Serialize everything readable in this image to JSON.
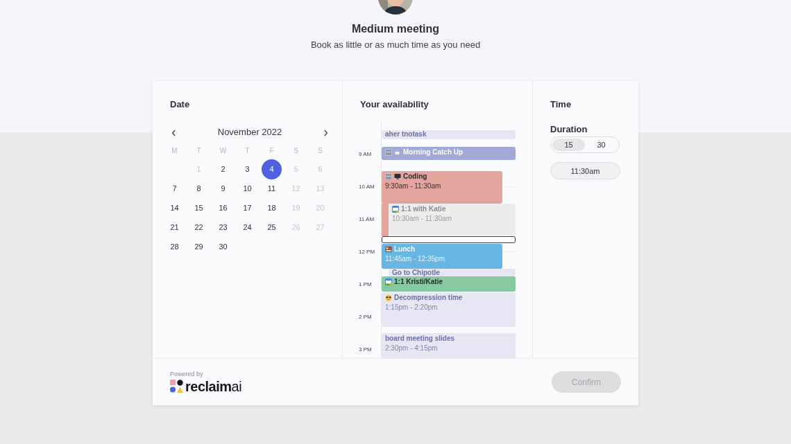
{
  "header": {
    "title": "Medium meeting",
    "subtitle": "Book as little or as much time as you need"
  },
  "date": {
    "heading": "Date",
    "month": "November 2022",
    "prev": "‹",
    "next": "›",
    "weekdays": [
      "M",
      "T",
      "W",
      "T",
      "F",
      "S",
      "S"
    ],
    "weeks": [
      [
        {
          "label": "1",
          "muted": true,
          "selected": false
        },
        {
          "label": "2",
          "muted": false,
          "selected": false
        },
        {
          "label": "3",
          "muted": false,
          "selected": false
        },
        {
          "label": "4",
          "muted": false,
          "selected": true
        },
        {
          "label": "5",
          "muted": true,
          "selected": false
        },
        {
          "label": "6",
          "muted": true,
          "selected": false
        }
      ],
      [
        {
          "label": "7",
          "muted": false,
          "selected": false
        },
        {
          "label": "8",
          "muted": false,
          "selected": false
        },
        {
          "label": "9",
          "muted": false,
          "selected": false
        },
        {
          "label": "10",
          "muted": false,
          "selected": false
        },
        {
          "label": "11",
          "muted": false,
          "selected": false
        },
        {
          "label": "12",
          "muted": true,
          "selected": false
        },
        {
          "label": "13",
          "muted": true,
          "selected": false
        }
      ],
      [
        {
          "label": "14",
          "muted": false,
          "selected": false
        },
        {
          "label": "15",
          "muted": false,
          "selected": false
        },
        {
          "label": "16",
          "muted": false,
          "selected": false
        },
        {
          "label": "17",
          "muted": false,
          "selected": false
        },
        {
          "label": "18",
          "muted": false,
          "selected": false
        },
        {
          "label": "19",
          "muted": true,
          "selected": false
        },
        {
          "label": "20",
          "muted": true,
          "selected": false
        }
      ],
      [
        {
          "label": "21",
          "muted": false,
          "selected": false
        },
        {
          "label": "22",
          "muted": false,
          "selected": false
        },
        {
          "label": "23",
          "muted": false,
          "selected": false
        },
        {
          "label": "24",
          "muted": false,
          "selected": false
        },
        {
          "label": "25",
          "muted": false,
          "selected": false
        },
        {
          "label": "26",
          "muted": true,
          "selected": false
        },
        {
          "label": "27",
          "muted": true,
          "selected": false
        }
      ],
      [
        {
          "label": "28",
          "muted": false,
          "selected": false
        },
        {
          "label": "29",
          "muted": false,
          "selected": false
        },
        {
          "label": "30",
          "muted": false,
          "selected": false
        }
      ]
    ]
  },
  "availability": {
    "heading": "Your availability",
    "hours": [
      "9 AM",
      "10 AM",
      "11 AM",
      "12 PM",
      "1 PM",
      "2 PM",
      "3 PM"
    ],
    "events": [
      {
        "kind": "plain",
        "title": "aher tnotask",
        "color": "#e6e7f3"
      },
      {
        "kind": "reclaim",
        "title": "Morning Catch Up",
        "color": "#a2a9d6"
      },
      {
        "kind": "reclaim",
        "title": "Coding",
        "time": "9:30am - 11:30am",
        "color": "#e4a59f"
      },
      {
        "kind": "google",
        "title": "1:1 with Katie",
        "time": "10:30am - 11:30am",
        "color": "#ededed"
      },
      {
        "kind": "slot"
      },
      {
        "kind": "plain",
        "title": "Lunch",
        "time": "11:45am - 12:35pm",
        "color": "#67b6e4"
      },
      {
        "kind": "plain",
        "title": "Go to Chipotle",
        "color": "#e6e7f3"
      },
      {
        "kind": "google",
        "title": "1:1 Kristi/Katie",
        "color": "#87c9a2"
      },
      {
        "kind": "plain",
        "title": "Decompression time",
        "time": "1:15pm - 2:20pm",
        "color": "#e6e7f3"
      },
      {
        "kind": "plain",
        "title": "board meeting slides",
        "time": "2:30pm - 4:15pm",
        "color": "#e6e7f3"
      }
    ]
  },
  "time": {
    "heading": "Time",
    "duration_label": "Duration",
    "durations": [
      {
        "label": "15",
        "selected": true
      },
      {
        "label": "30",
        "selected": false
      }
    ],
    "slots": [
      {
        "label": "11:30am",
        "selected": false
      }
    ]
  },
  "footer": {
    "powered_by": "Powered by",
    "brand": "**reclaim**ai",
    "confirm": {
      "label": "Confirm",
      "disabled": true
    }
  }
}
